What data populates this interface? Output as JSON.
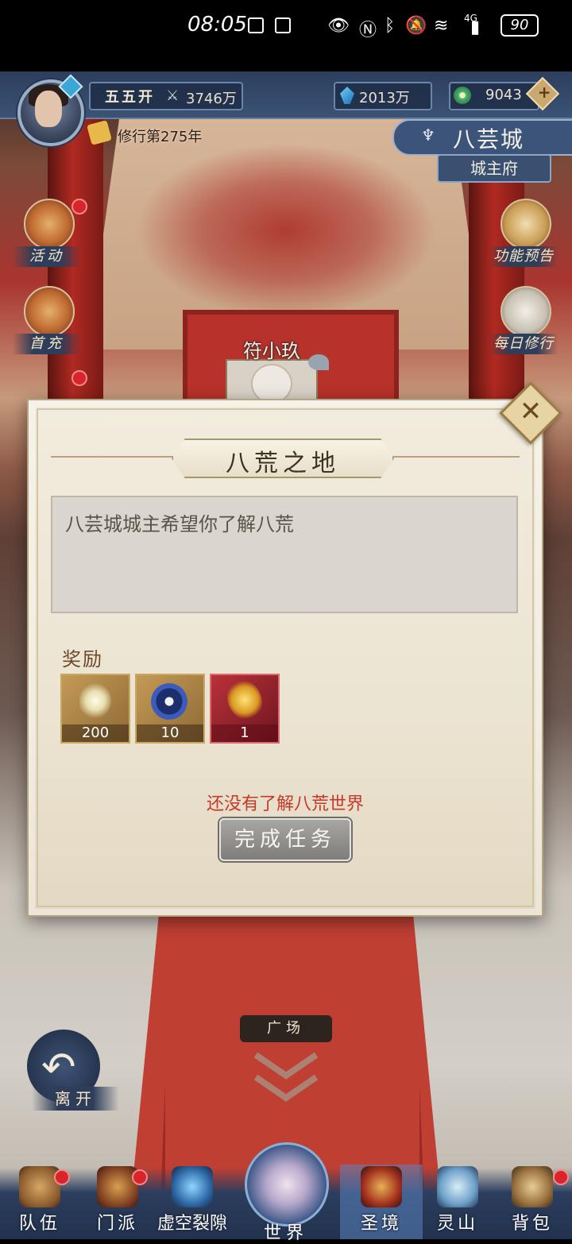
{
  "status_bar": {
    "time": "08:05",
    "battery": "90",
    "network": "4G"
  },
  "hud": {
    "player_name": "五五开",
    "power": "3746万",
    "gems": "2013万",
    "jade": "9043",
    "plus": "+",
    "cultivation": "修行第275年"
  },
  "location": {
    "city": "八芸城",
    "sub": "城主府"
  },
  "side_left": [
    {
      "label": "活动"
    },
    {
      "label": "首充"
    }
  ],
  "side_right": [
    {
      "label": "功能预告"
    },
    {
      "label": "每日修行"
    }
  ],
  "npc": {
    "name": "符小玖"
  },
  "dialog": {
    "title": "八荒之地",
    "description": "八芸城城主希望你了解八荒",
    "reward_label": "奖励",
    "rewards": [
      {
        "qty": "200",
        "icon": "essence-flame-icon"
      },
      {
        "qty": "10",
        "icon": "taiji-orb-icon"
      },
      {
        "qty": "1",
        "icon": "golden-dragon-icon"
      }
    ],
    "warning": "还没有了解八荒世界",
    "complete_button": "完成任务",
    "close": "✕"
  },
  "plaza": "广场",
  "leave": "离开",
  "nav": [
    {
      "label": "队伍"
    },
    {
      "label": "门派"
    },
    {
      "label": "虚空裂隙"
    },
    {
      "label": "世界"
    },
    {
      "label": "圣境"
    },
    {
      "label": "灵山"
    },
    {
      "label": "背包"
    }
  ],
  "colors": {
    "warning": "#c33a2a",
    "hud_blue": "#2c3e5c",
    "parchment": "#ece4d2"
  }
}
